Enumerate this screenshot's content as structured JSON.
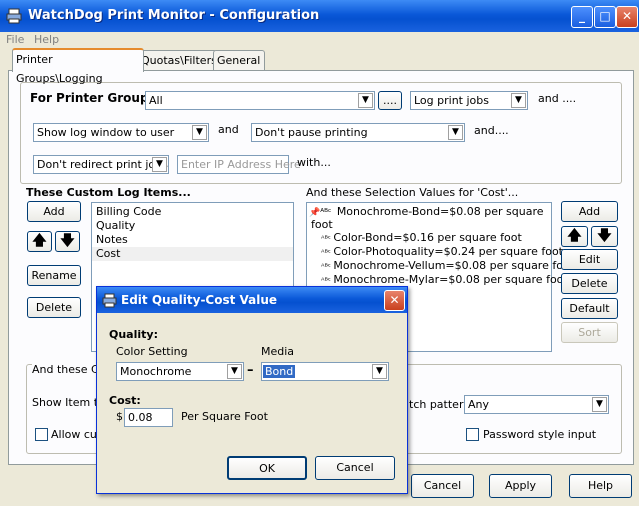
{
  "window": {
    "title": "WatchDog Print Monitor - Configuration"
  },
  "menu": {
    "file": "File",
    "help": "Help"
  },
  "tabs": [
    "Printer Groups\\Logging",
    "Quotas\\Filters",
    "General"
  ],
  "group": {
    "label": "For Printer Group",
    "value": "All",
    "browse": "....",
    "log_option": "Log print jobs",
    "and1": "and ....",
    "show_log": "Show log window to user",
    "and2": "and",
    "pause": "Don't pause printing",
    "and3": "and....",
    "redirect": "Don't redirect print jobs",
    "ip_placeholder": "Enter IP Address Here",
    "with": "with..."
  },
  "custom": {
    "header": "These Custom Log Items...",
    "add": "Add",
    "rename": "Rename",
    "delete": "Delete",
    "items": [
      "Billing Code",
      "Quality",
      "Notes",
      "Cost"
    ]
  },
  "selection": {
    "header": "And these Selection Values for 'Cost'...",
    "items": [
      "Monochrome-Bond=$0.08 per square foot",
      "Color-Bond=$0.16 per square foot",
      "Color-Photoquality=$0.24 per square foot",
      "Monochrome-Vellum=$0.08 per square foot",
      "Monochrome-Mylar=$0.08 per square foot"
    ],
    "add": "Add",
    "edit": "Edit",
    "delete": "Delete",
    "default": "Default",
    "sort": "Sort"
  },
  "lower": {
    "and_these": "And these Cu",
    "show_item": "Show Item to",
    "allow": "Allow cus",
    "match_pattern": "tch pattern:",
    "match_value": "Any",
    "password": "Password style input"
  },
  "footer": {
    "cancel": "Cancel",
    "apply": "Apply",
    "help": "Help"
  },
  "dialog": {
    "title": "Edit Quality-Cost Value",
    "quality": "Quality:",
    "color_setting": "Color Setting",
    "color_value": "Monochrome",
    "dash": "–",
    "media": "Media",
    "media_value": "Bond",
    "cost": "Cost:",
    "dollar": "$",
    "cost_value": "0.08",
    "per": "Per Square Foot",
    "ok": "OK",
    "cancel": "Cancel"
  }
}
